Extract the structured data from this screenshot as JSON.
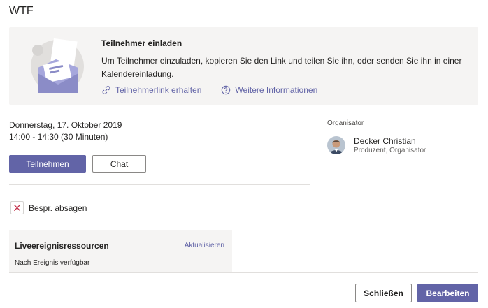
{
  "window": {
    "title": "WTF"
  },
  "invite": {
    "heading": "Teilnehmer einladen",
    "description": "Um Teilnehmer einzuladen, kopieren Sie den Link und teilen Sie ihn, oder senden Sie ihn in einer Kalendereinladung.",
    "get_link_label": "Teilnehmerlink erhalten",
    "more_info_label": "Weitere Informationen"
  },
  "meeting": {
    "date": "Donnerstag, 17. Oktober 2019",
    "time": "14:00 - 14:30 (30 Minuten)",
    "join_label": "Teilnehmen",
    "chat_label": "Chat",
    "decline_label": "Bespr. absagen"
  },
  "resources": {
    "title": "Liveereignisressourcen",
    "refresh_label": "Aktualisieren",
    "status": "Nach Ereignis verfügbar"
  },
  "organizer": {
    "section_label": "Organisator",
    "name": "Decker Christian",
    "role": "Produzent, Organisator"
  },
  "footer": {
    "close_label": "Schließen",
    "edit_label": "Bearbeiten"
  },
  "colors": {
    "accent": "#6264a7",
    "banner_bg": "#f5f4f3",
    "decline_icon": "#c4314b"
  }
}
